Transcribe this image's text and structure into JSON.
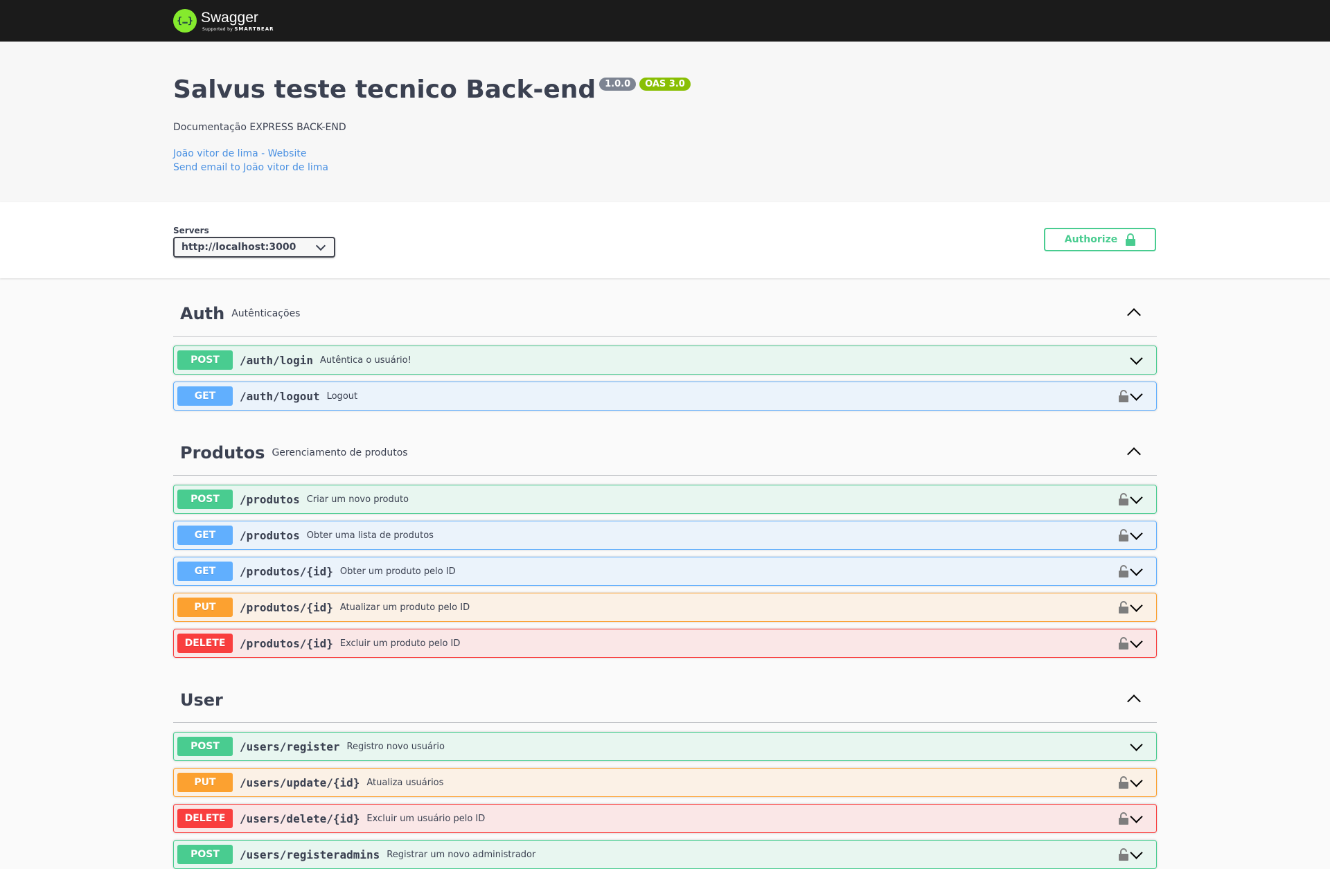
{
  "topbar": {
    "logo_icon": "{…}",
    "logo_name": "Swagger",
    "logo_supported": "Supported by",
    "logo_company": "SMARTBEAR"
  },
  "info": {
    "title": "Salvus teste tecnico Back-end",
    "version": "1.0.0",
    "oas": "OAS 3.0",
    "description": "Documentação EXPRESS BACK-END",
    "website_link": "João vitor de lima - Website",
    "email_link": "Send email to João vitor de lima"
  },
  "scheme": {
    "servers_label": "Servers",
    "server_value": "http://localhost:3000",
    "authorize_label": "Authorize"
  },
  "colors": {
    "post": "#49cc90",
    "get": "#61affe",
    "put": "#fca130",
    "delete": "#f93e3e"
  },
  "tags": [
    {
      "name": "Auth",
      "description": "Autênticações",
      "operations": [
        {
          "method": "POST",
          "path": "/auth/login",
          "summary": "Autêntica o usuário!",
          "locked": false
        },
        {
          "method": "GET",
          "path": "/auth/logout",
          "summary": "Logout",
          "locked": true
        }
      ]
    },
    {
      "name": "Produtos",
      "description": "Gerenciamento de produtos",
      "operations": [
        {
          "method": "POST",
          "path": "/produtos",
          "summary": "Criar um novo produto",
          "locked": true
        },
        {
          "method": "GET",
          "path": "/produtos",
          "summary": "Obter uma lista de produtos",
          "locked": true
        },
        {
          "method": "GET",
          "path": "/produtos/{id}",
          "summary": "Obter um produto pelo ID",
          "locked": true
        },
        {
          "method": "PUT",
          "path": "/produtos/{id}",
          "summary": "Atualizar um produto pelo ID",
          "locked": true
        },
        {
          "method": "DELETE",
          "path": "/produtos/{id}",
          "summary": "Excluir um produto pelo ID",
          "locked": true
        }
      ]
    },
    {
      "name": "User",
      "description": "",
      "operations": [
        {
          "method": "POST",
          "path": "/users/register",
          "summary": "Registro novo usuário",
          "locked": false
        },
        {
          "method": "PUT",
          "path": "/users/update/{id}",
          "summary": "Atualiza usuários",
          "locked": true
        },
        {
          "method": "DELETE",
          "path": "/users/delete/{id}",
          "summary": "Excluir um usuário pelo ID",
          "locked": true
        },
        {
          "method": "POST",
          "path": "/users/registeradmins",
          "summary": "Registrar um novo administrador",
          "locked": true
        }
      ]
    }
  ]
}
